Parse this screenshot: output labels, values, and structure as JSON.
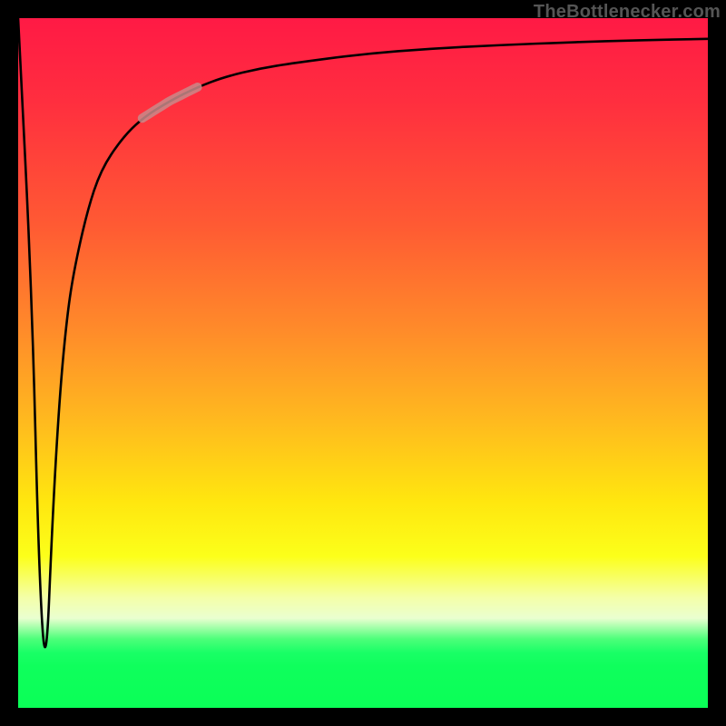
{
  "watermark": "TheBottlenecker.com",
  "colors": {
    "frame_bg": "#000000",
    "watermark_text": "#555555",
    "curve_stroke": "#000000",
    "highlight_stroke": "#c98a8a"
  },
  "chart_data": {
    "type": "line",
    "title": "",
    "xlabel": "",
    "ylabel": "",
    "xlim": [
      0,
      100
    ],
    "ylim": [
      0,
      100
    ],
    "grid": false,
    "legend": false,
    "series": [
      {
        "name": "bottleneck-curve",
        "x": [
          0,
          2,
          3,
          4,
          5,
          6,
          7,
          8,
          10,
          12,
          15,
          18,
          22,
          26,
          30,
          35,
          40,
          50,
          60,
          70,
          80,
          90,
          100
        ],
        "y": [
          100,
          60,
          20,
          4,
          28,
          45,
          56,
          63,
          72,
          78,
          82.5,
          85.5,
          88,
          90,
          91.5,
          92.7,
          93.5,
          94.8,
          95.6,
          96.1,
          96.5,
          96.8,
          97.0
        ]
      }
    ],
    "annotations": [
      {
        "name": "highlight-segment",
        "kind": "segment-overlay",
        "x_range": [
          18,
          26
        ],
        "stroke_width": 10
      }
    ]
  }
}
